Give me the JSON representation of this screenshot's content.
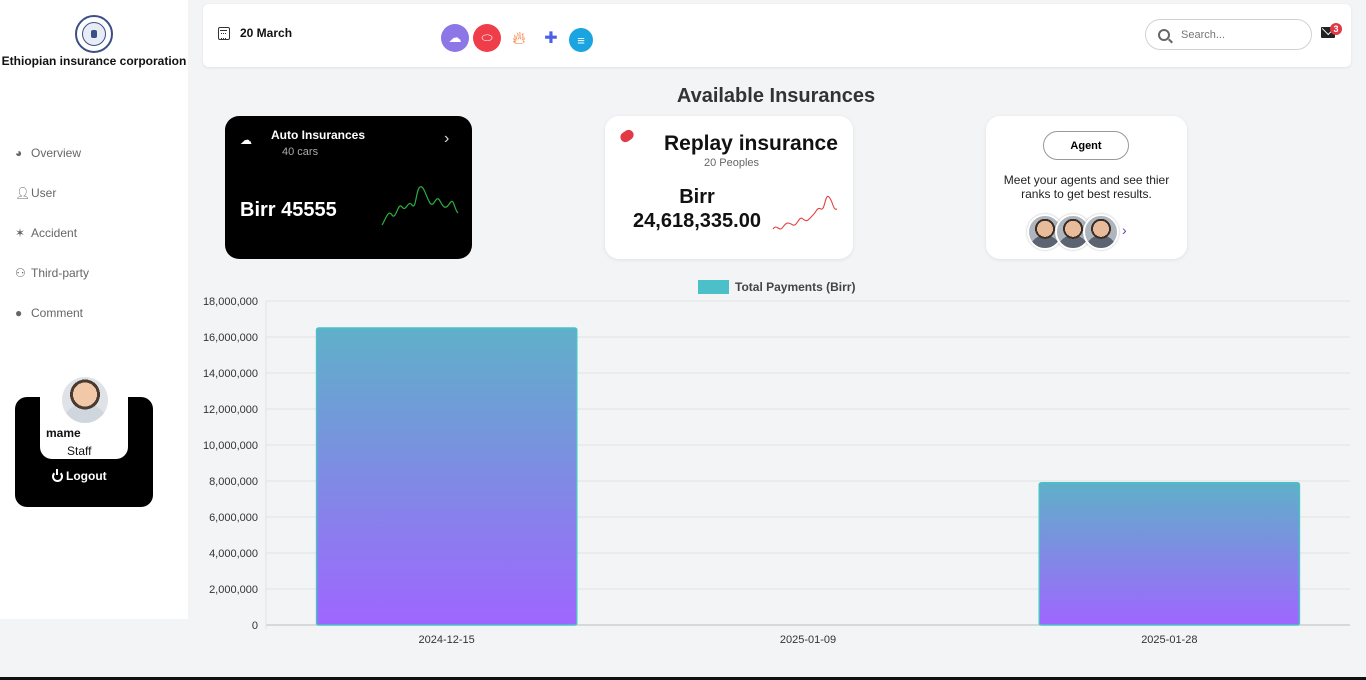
{
  "sidebar": {
    "org_name": "Ethiopian insurance corporation",
    "items": [
      {
        "label": "Overview",
        "icon": "dashboard-icon"
      },
      {
        "label": "User",
        "icon": "user-icon"
      },
      {
        "label": "Accident",
        "icon": "car-crash-icon"
      },
      {
        "label": "Third-party",
        "icon": "users-icon"
      },
      {
        "label": "Comment",
        "icon": "comment-icon"
      }
    ],
    "user": {
      "name": "mame",
      "role": "Staff",
      "logout_label": "Logout"
    }
  },
  "header": {
    "date": "20 March",
    "search_placeholder": "Search...",
    "mail_badge": "3",
    "quick_icons": [
      "cloud-car-icon",
      "pill-icon",
      "fire-icon",
      "medical-icon",
      "chat-icon"
    ]
  },
  "section_title": "Available Insurances",
  "cards": {
    "auto": {
      "title": "Auto Insurances",
      "sub": "40 cars",
      "amount": "Birr 45555"
    },
    "replay": {
      "title": "Replay insurance",
      "sub": "20 Peoples",
      "amount_line1": "Birr",
      "amount_line2": "24,618,335.00"
    },
    "agent": {
      "button": "Agent",
      "description": "Meet your agents and see thier ranks to get best results."
    }
  },
  "colors": {
    "bar_top": "#5fb0c9",
    "bar_bottom": "#9f66ff",
    "bar_border": "#4bc0c8",
    "legend": "#4bc0c8"
  },
  "chart_data": {
    "type": "bar",
    "categories": [
      "2024-12-15",
      "2025-01-09",
      "2025-01-28"
    ],
    "series": [
      {
        "name": "Total Payments (Birr)",
        "values": [
          16500000,
          0,
          7900000
        ]
      }
    ],
    "ylim": [
      0,
      18000000
    ],
    "yticks": [
      "18,000,000",
      "16,000,000",
      "14,000,000",
      "12,000,000",
      "10,000,000",
      "8,000,000",
      "6,000,000",
      "4,000,000",
      "2,000,000",
      "0"
    ],
    "legend_position": "top",
    "grid": true
  }
}
